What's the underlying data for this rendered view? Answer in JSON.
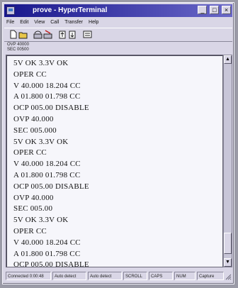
{
  "window": {
    "title": "prove - HyperTerminal"
  },
  "title_buttons": {
    "minimize": "_",
    "maximize": "□",
    "close": "×"
  },
  "menu": [
    "File",
    "Edit",
    "View",
    "Call",
    "Transfer",
    "Help"
  ],
  "toolbar": {
    "tools": [
      "new-icon",
      "open-icon",
      "call-icon",
      "disconnect-icon",
      "send-icon",
      "receive-icon",
      "properties-icon"
    ]
  },
  "status_info": {
    "line1": "OVP 40000",
    "line2": "SEC 00500"
  },
  "terminal": {
    "lines": [
      "5V  OK  3.3V  OK",
      "OPER  CC",
      "V 40.000  18.204  CC",
      "A 01.800  01.798  CC",
      "OCP  005.00  DISABLE",
      "OVP  40.000",
      "SEC  005.000",
      "5V  OK  3.3V  OK",
      "OPER  CC",
      "V 40.000  18.204  CC",
      "A 01.800  01.798  CC",
      "OCP  005.00  DISABLE",
      "OVP  40.000",
      "SEC  005.00",
      "5V  OK  3.3V  OK",
      "OPER  CC",
      "V 40.000  18.204  CC",
      "A 01.800  01.798  CC",
      "OCP  005.00  DISABLE"
    ]
  },
  "scrollbar": {
    "up": "▲",
    "down": "▼"
  },
  "statusbar": {
    "connected": "Connected 0:00:48",
    "detect1": "Auto detect",
    "detect2": "Auto detect",
    "pane4": "SCROLL",
    "pane5": "CAPS",
    "pane6": "NUM",
    "pane7": "Capture"
  }
}
